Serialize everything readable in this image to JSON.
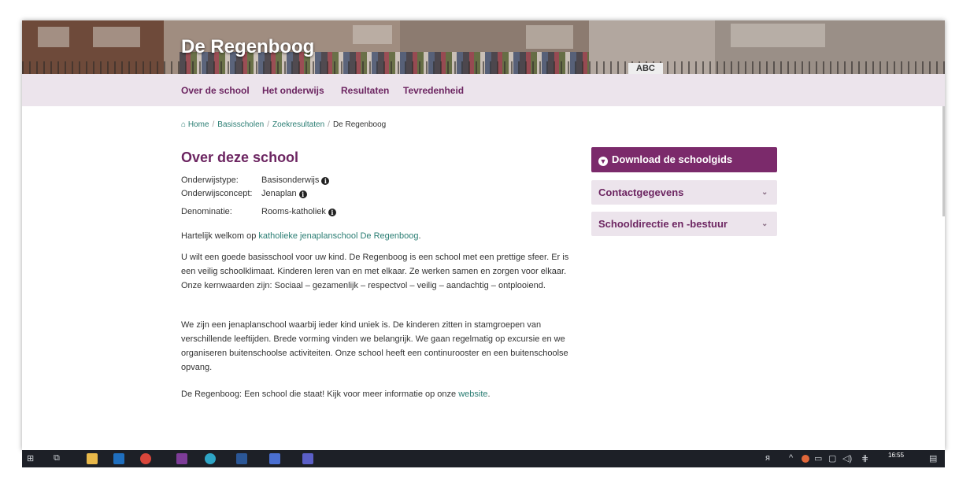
{
  "header": {
    "school_name": "De Regenboog",
    "banner_sign": "ABC"
  },
  "nav": {
    "items": [
      "Over de school",
      "Het onderwijs",
      "Resultaten",
      "Tevredenheid"
    ]
  },
  "breadcrumb": {
    "home": "Home",
    "items": [
      "Basisscholen",
      "Zoekresultaten"
    ],
    "current": "De Regenboog",
    "separator": "/"
  },
  "main": {
    "heading": "Over deze school",
    "meta": [
      {
        "key": "Onderwijstype:",
        "value": "Basisonderwijs"
      },
      {
        "key": "Onderwijsconcept:",
        "value": "Jenaplan"
      },
      {
        "key": "Denominatie:",
        "value": "Rooms-katholiek"
      }
    ],
    "welcome_prefix": "Hartelijk welkom op ",
    "welcome_link": "katholieke jenaplanschool De Regenboog",
    "welcome_suffix": ".",
    "para1": "U wilt een goede basisschool voor uw kind. De Regenboog is een school met een prettige sfeer. Er is een veilig schoolklimaat. Kinderen leren van en met elkaar. Ze werken samen en zorgen voor elkaar. Onze kernwaarden zijn: Sociaal – gezamenlijk – respectvol – veilig – aandachtig – ontplooiend.",
    "para2": "We zijn een jenaplanschool waarbij ieder kind uniek is. De kinderen zitten in stamgroepen van verschillende leeftijden. Brede vorming vinden we belangrijk. We gaan regelmatig op excursie en we organiseren buitenschoolse activiteiten. Onze school heeft een continurooster en een buitenschoolse opvang.",
    "closing_prefix": "De Regenboog: Een school die staat! Kijk voor meer informatie op onze ",
    "closing_link": "website",
    "closing_suffix": "."
  },
  "sidebar": {
    "download_label": "Download de schoolgids",
    "accordions": [
      "Contactgegevens",
      "Schooldirectie en -bestuur"
    ]
  },
  "taskbar": {
    "time": "16:55"
  },
  "colors": {
    "brand": "#6c2561",
    "nav_bg": "#ece4ec",
    "link": "#2a7d73",
    "button": "#7b2a6b"
  }
}
